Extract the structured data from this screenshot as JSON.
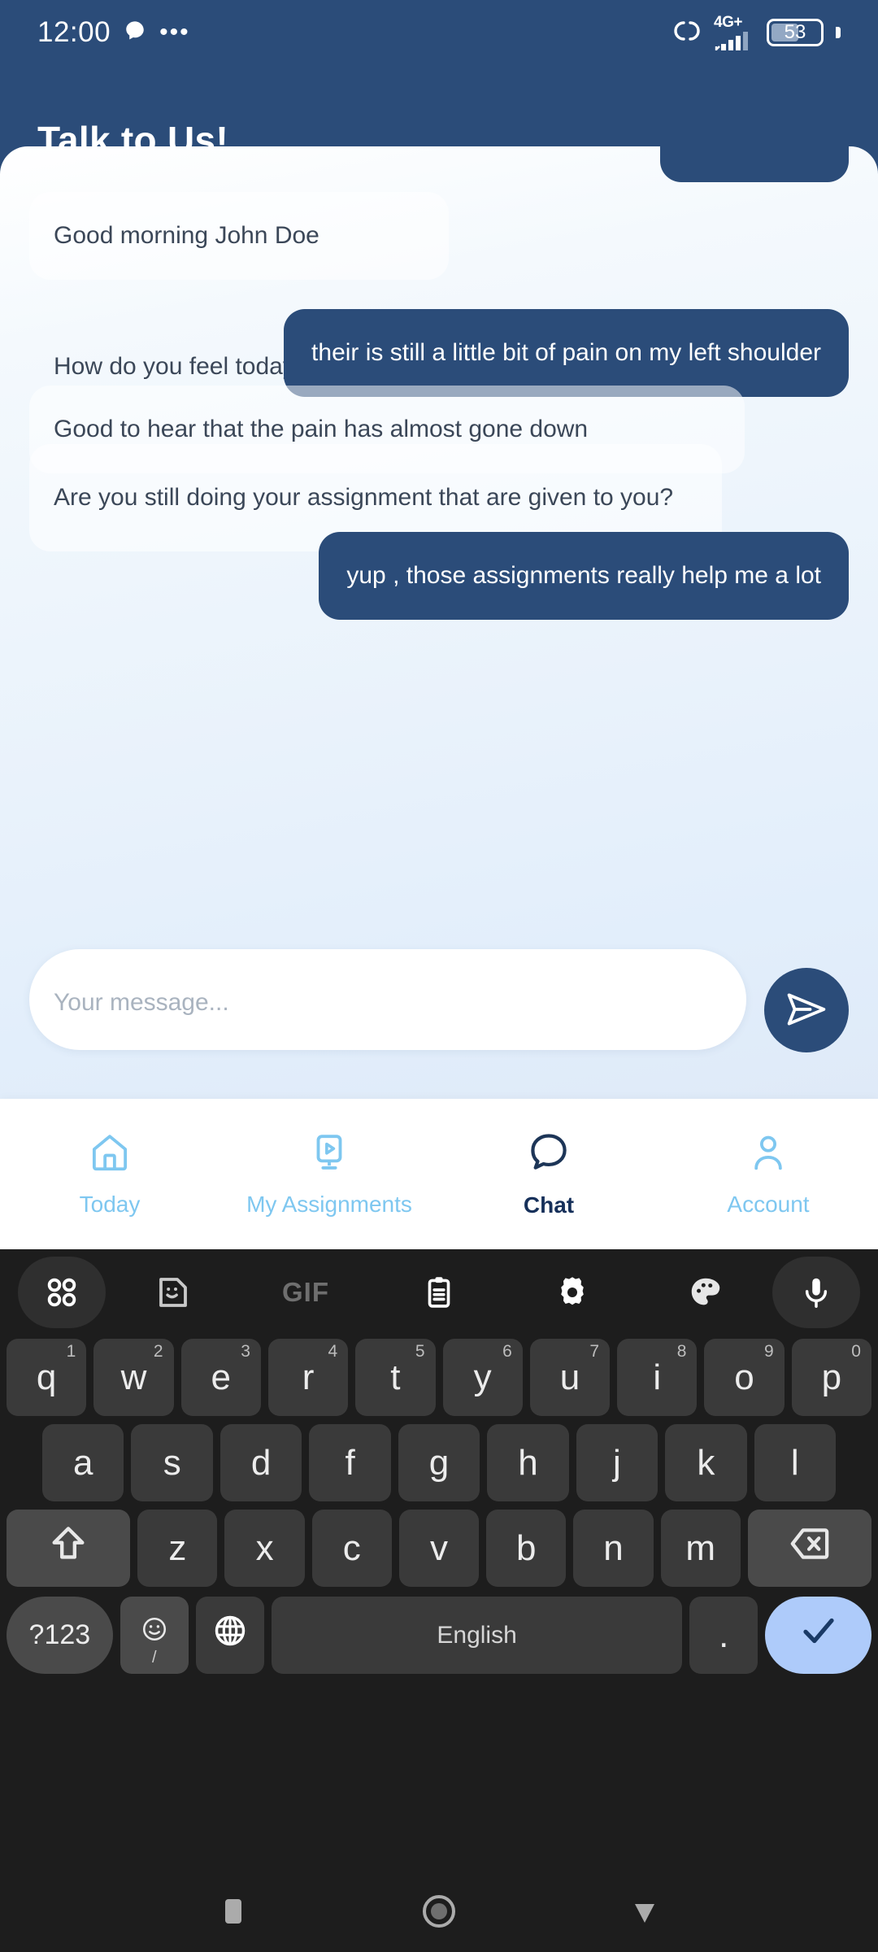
{
  "status_bar": {
    "time": "12:00",
    "notification_icon": "chat-bubble-icon",
    "overflow_icon": "more-dots-icon",
    "link_icon": "link-chain-icon",
    "network_label": "4G+",
    "signal_icon": "signal-bars-icon",
    "battery_level": "53"
  },
  "header": {
    "title": "Talk to Us!",
    "background_color": "#2b4c79"
  },
  "chat": {
    "messages": [
      {
        "id": "m0",
        "from": "user",
        "text": "",
        "clipped": true
      },
      {
        "id": "m1",
        "from": "bot",
        "text": "Good morning  John Doe"
      },
      {
        "id": "m2",
        "from": "bot",
        "text": "How do you feel today?"
      },
      {
        "id": "m3",
        "from": "user",
        "text": "their is still a little bit of pain on my left shoulder"
      },
      {
        "id": "m4",
        "from": "bot",
        "text": "Good to hear that the pain has almost gone down"
      },
      {
        "id": "m5",
        "from": "bot",
        "text": "Are you still doing your assignment that are given to you?"
      },
      {
        "id": "m6",
        "from": "user",
        "text": "yup , those assignments really help me a lot"
      }
    ],
    "outgoing_color": "#2b4c79",
    "incoming_color": "#ffffff"
  },
  "composer": {
    "placeholder": "Your message...",
    "value": "",
    "send_icon": "send-paper-plane-icon"
  },
  "bottom_nav": {
    "active_color": "#16305a",
    "inactive_color": "#7ec7f0",
    "items": [
      {
        "label": "Today",
        "icon": "home-icon",
        "active": false
      },
      {
        "label": "My Assignments",
        "icon": "video-monitor-icon",
        "active": false
      },
      {
        "label": "Chat",
        "icon": "chat-bubble-icon",
        "active": true
      },
      {
        "label": "Account",
        "icon": "person-icon",
        "active": false
      }
    ]
  },
  "keyboard": {
    "toolbar": [
      {
        "icon": "apps-grid-icon",
        "pill": true
      },
      {
        "icon": "sticker-icon",
        "pill": false
      },
      {
        "icon": "gif-icon",
        "label": "GIF",
        "pill": false
      },
      {
        "icon": "clipboard-icon",
        "pill": false
      },
      {
        "icon": "gear-icon",
        "pill": false
      },
      {
        "icon": "palette-icon",
        "pill": false
      },
      {
        "icon": "microphone-icon",
        "pill": true
      }
    ],
    "row1": [
      {
        "key": "q",
        "num": "1"
      },
      {
        "key": "w",
        "num": "2"
      },
      {
        "key": "e",
        "num": "3"
      },
      {
        "key": "r",
        "num": "4"
      },
      {
        "key": "t",
        "num": "5"
      },
      {
        "key": "y",
        "num": "6"
      },
      {
        "key": "u",
        "num": "7"
      },
      {
        "key": "i",
        "num": "8"
      },
      {
        "key": "o",
        "num": "9"
      },
      {
        "key": "p",
        "num": "0"
      }
    ],
    "row2": [
      "a",
      "s",
      "d",
      "f",
      "g",
      "h",
      "j",
      "k",
      "l"
    ],
    "row3": [
      "z",
      "x",
      "c",
      "v",
      "b",
      "n",
      "m"
    ],
    "shift_icon": "shift-up-arrow-icon",
    "backspace_icon": "backspace-icon",
    "symbols_label": "?123",
    "emoji_icon": "emoji-smiley-icon",
    "emoji_sub": "/",
    "language_icon": "globe-icon",
    "space_label": "English",
    "period_label": ".",
    "enter_icon": "checkmark-icon"
  },
  "android_nav": {
    "recents_icon": "square-recents-icon",
    "home_icon": "circle-home-icon",
    "back_icon": "triangle-back-icon"
  }
}
